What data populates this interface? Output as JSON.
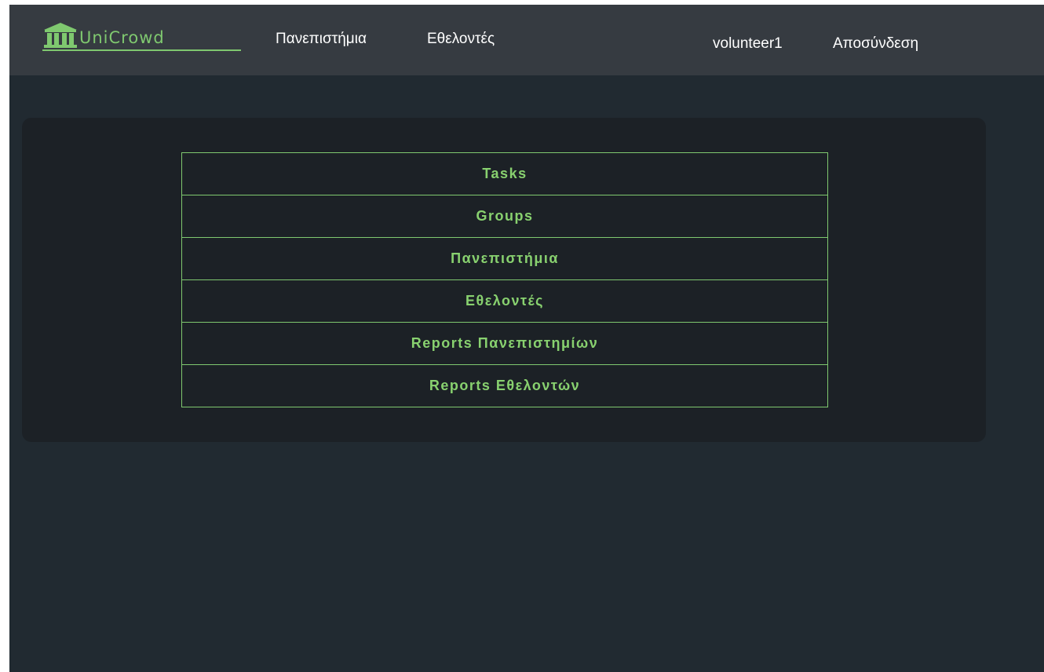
{
  "brand": {
    "name": "UniCrowd",
    "icon": "bank-columns-icon",
    "color": "#7fc86f"
  },
  "nav": {
    "universities": "Πανεπιστήμια",
    "volunteers": "Εθελοντές",
    "user": "volunteer1",
    "logout": "Αποσύνδεση"
  },
  "menu": {
    "items": [
      {
        "label": "Tasks"
      },
      {
        "label": "Groups"
      },
      {
        "label": "Πανεπιστήμια"
      },
      {
        "label": "Εθελοντές"
      },
      {
        "label": "Reports Πανεπιστημίων"
      },
      {
        "label": "Reports Εθελοντών"
      }
    ]
  },
  "colors": {
    "background": "#212a31",
    "navbar": "#363b41",
    "card": "#1c2126",
    "accent": "#7fc86f"
  }
}
